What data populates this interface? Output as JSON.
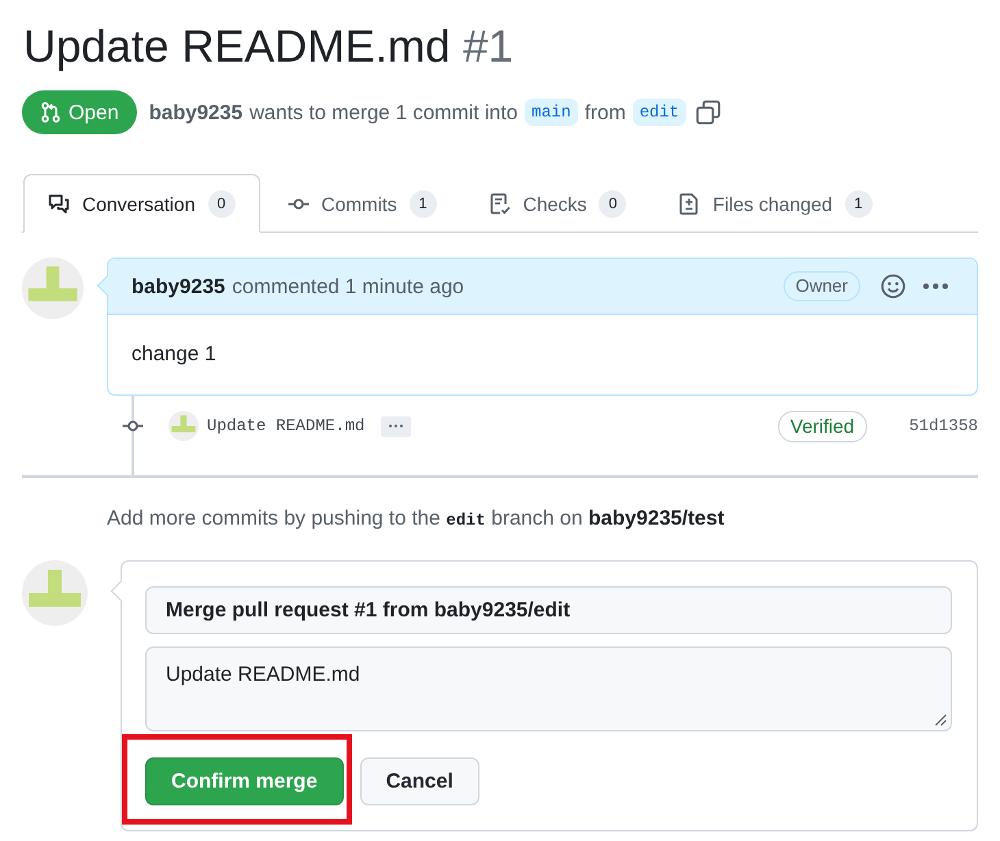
{
  "title": {
    "text": "Update README.md",
    "number": "#1"
  },
  "status": {
    "label": "Open"
  },
  "summary": {
    "author": "baby9235",
    "text": "wants to merge 1 commit into",
    "base_branch": "main",
    "from_text": "from",
    "head_branch": "edit"
  },
  "tabs": [
    {
      "kind": "conversation",
      "label": "Conversation",
      "count": "0",
      "selected": true
    },
    {
      "kind": "commits",
      "label": "Commits",
      "count": "1",
      "selected": false
    },
    {
      "kind": "checks",
      "label": "Checks",
      "count": "0",
      "selected": false
    },
    {
      "kind": "files",
      "label": "Files changed",
      "count": "1",
      "selected": false
    }
  ],
  "comment": {
    "author": "baby9235",
    "action": "commented 1 minute ago",
    "role_badge": "Owner",
    "body": "change 1"
  },
  "commit": {
    "message": "Update README.md",
    "verified_badge": "Verified",
    "sha": "51d1358"
  },
  "hint": {
    "before": "Add more commits by pushing to the",
    "branch": "edit",
    "middle": "branch on",
    "repo": "baby9235/test"
  },
  "merge_form": {
    "title_value": "Merge pull request #1 from baby9235/edit",
    "message_value": "Update README.md",
    "buttons": [
      {
        "kind": "primary",
        "label": "Confirm merge",
        "highlighted": true
      },
      {
        "kind": "secondary",
        "label": "Cancel"
      }
    ]
  }
}
